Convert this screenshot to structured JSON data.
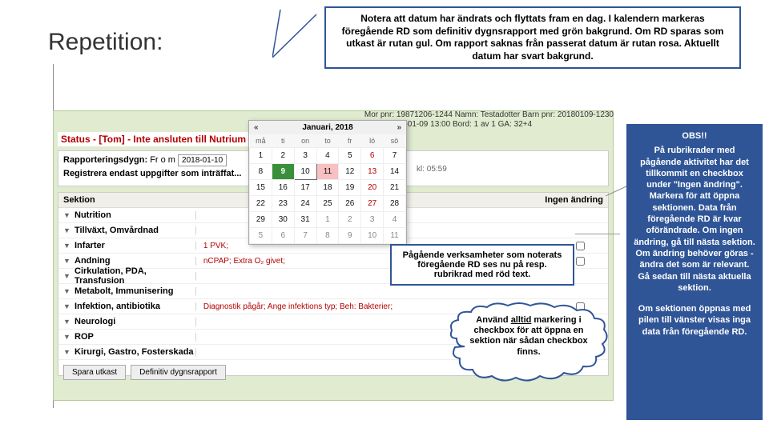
{
  "title": "Repetition:",
  "top_callout": "Notera att datum har ändrats och flyttats fram en dag. I kalendern markeras föregående RD som definitiv dygnsrapport med grön bakgrund. Om RD sparas som utkast är rutan gul. Om rapport saknas från passerat datum är rutan rosa. Aktuellt datum har svart bakgrund.",
  "patient": {
    "l1": "Mor pnr: 19871206-1244   Namn: Testadotter Barn pnr: 20180109-1230",
    "l2": "Född: 2018-01-09 13:00  Bord: 1 av 1                 GA: 32+4"
  },
  "status": "Status - [Tom] - Inte ansluten till Nutrium",
  "rap": {
    "l1a": "Rapporteringsdygn:",
    "l1b": "Fr o m",
    "date": "2018-01-10",
    "hint": "kl: 05:59",
    "l2": "Registrera endast uppgifter som inträffat..."
  },
  "sektion": {
    "head1": "Sektion",
    "head2": "Ingen ändring",
    "rows": [
      {
        "name": "Nutrition",
        "note": ""
      },
      {
        "name": "Tillväxt, Omvårdnad",
        "note": ""
      },
      {
        "name": "Infarter",
        "note": "1 PVK;"
      },
      {
        "name": "Andning",
        "note": "nCPAP; Extra O₂ givet;"
      },
      {
        "name": "Cirkulation, PDA, Transfusion",
        "note": ""
      },
      {
        "name": "Metabolt, Immunisering",
        "note": ""
      },
      {
        "name": "Infektion, antibiotika",
        "note": "Diagnostik pågår; Ange infektions typ; Beh: Bakterier;"
      },
      {
        "name": "Neurologi",
        "note": ""
      },
      {
        "name": "ROP",
        "note": ""
      },
      {
        "name": "Kirurgi, Gastro, Fosterskada",
        "note": ""
      }
    ],
    "btn1": "Spara utkast",
    "btn2": "Definitiv dygnsrapport"
  },
  "calendar": {
    "prev": "«",
    "next": "»",
    "title": "Januari, 2018",
    "dow": [
      "må",
      "ti",
      "on",
      "to",
      "fr",
      "lö",
      "sö"
    ],
    "weeks": [
      [
        {
          "d": "1"
        },
        {
          "d": "2"
        },
        {
          "d": "3"
        },
        {
          "d": "4"
        },
        {
          "d": "5"
        },
        {
          "d": "6",
          "red": true
        },
        {
          "d": "7"
        }
      ],
      [
        {
          "d": "8"
        },
        {
          "d": "9",
          "green": true
        },
        {
          "d": "10",
          "outline": true
        },
        {
          "d": "11",
          "pink": true
        },
        {
          "d": "12"
        },
        {
          "d": "13",
          "red": true
        },
        {
          "d": "14"
        }
      ],
      [
        {
          "d": "15"
        },
        {
          "d": "16"
        },
        {
          "d": "17"
        },
        {
          "d": "18"
        },
        {
          "d": "19"
        },
        {
          "d": "20",
          "red": true
        },
        {
          "d": "21"
        }
      ],
      [
        {
          "d": "22"
        },
        {
          "d": "23"
        },
        {
          "d": "24"
        },
        {
          "d": "25"
        },
        {
          "d": "26"
        },
        {
          "d": "27",
          "red": true
        },
        {
          "d": "28"
        }
      ],
      [
        {
          "d": "29"
        },
        {
          "d": "30"
        },
        {
          "d": "31"
        },
        {
          "d": "1",
          "out": true
        },
        {
          "d": "2",
          "out": true
        },
        {
          "d": "3",
          "out": true
        },
        {
          "d": "4",
          "out": true
        }
      ],
      [
        {
          "d": "5",
          "out": true
        },
        {
          "d": "6",
          "out": true
        },
        {
          "d": "7",
          "out": true
        },
        {
          "d": "8",
          "out": true
        },
        {
          "d": "9",
          "out": true
        },
        {
          "d": "10",
          "out": true
        },
        {
          "d": "11",
          "out": true
        }
      ]
    ]
  },
  "call1": "Pågående verksamheter som noterats föregående RD ses nu på resp. rubrikrad med röd text.",
  "cloud": {
    "t1": "Använd ",
    "u": "alltid",
    "t2": " markering i checkbox för att öppna en sektion när sådan checkbox finns."
  },
  "right": {
    "obs": "OBS!!",
    "p1": "På rubrikrader med pågående aktivitet har det tillkommit en checkbox under \"Ingen ändring\". Markera för att öppna sektionen. Data från föregående RD är kvar oförändrade. Om ingen ändring,  gå till nästa sektion. Om ändring behöver göras - ändra det som är relevant. Gå sedan till nästa aktuella sektion.",
    "p2": "Om sektionen öppnas med pilen till vänster visas inga data från föregående RD."
  }
}
